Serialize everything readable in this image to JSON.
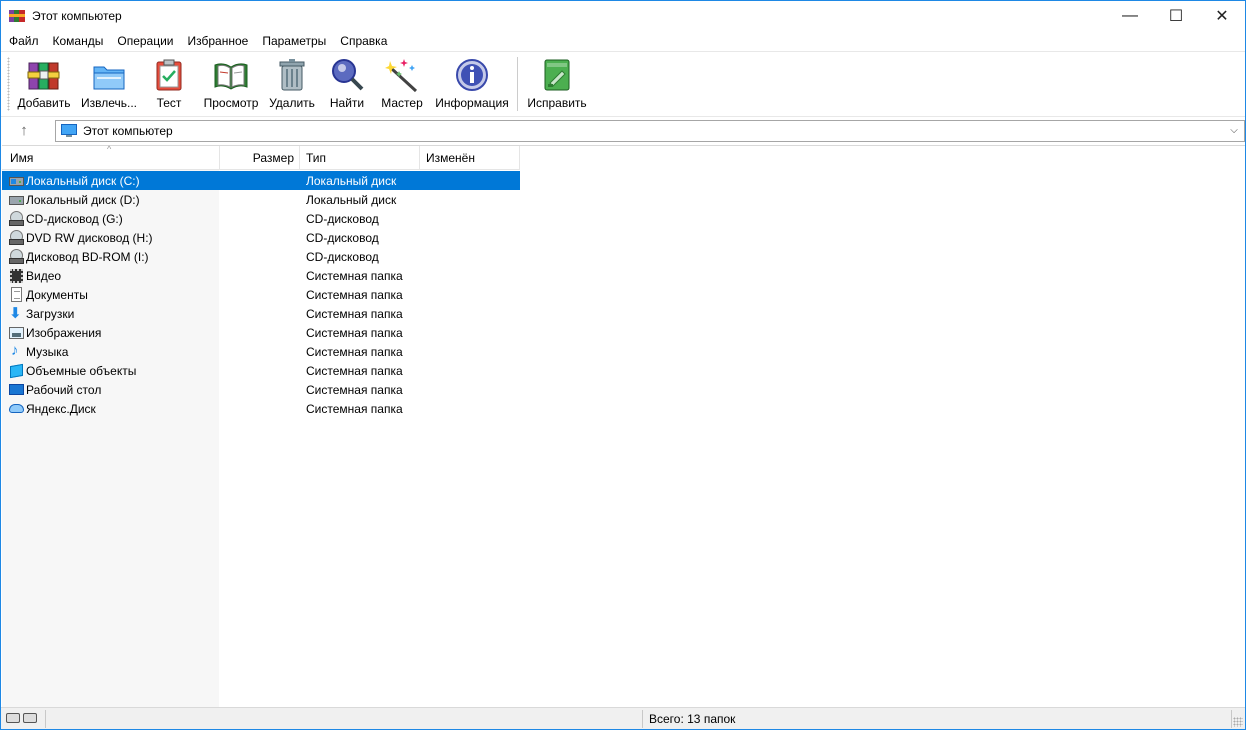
{
  "window": {
    "title": "Этот компьютер",
    "controls": {
      "minimize": "—",
      "maximize": "☐",
      "close": "✕"
    }
  },
  "menu": [
    "Файл",
    "Команды",
    "Операции",
    "Избранное",
    "Параметры",
    "Справка"
  ],
  "toolbar": {
    "buttons": [
      {
        "label": "Добавить",
        "icon": "add-archive-icon"
      },
      {
        "label": "Извлечь...",
        "icon": "extract-folder-icon"
      },
      {
        "label": "Тест",
        "icon": "test-clipboard-icon"
      },
      {
        "label": "Просмотр",
        "icon": "view-book-icon"
      },
      {
        "label": "Удалить",
        "icon": "trash-icon"
      },
      {
        "label": "Найти",
        "icon": "search-magnifier-icon"
      },
      {
        "label": "Мастер",
        "icon": "wizard-wand-icon"
      },
      {
        "label": "Информация",
        "icon": "info-icon"
      },
      {
        "label": "Исправить",
        "icon": "repair-icon"
      }
    ]
  },
  "address": {
    "up_symbol": "↑",
    "path": "Этот компьютер",
    "dropdown_symbol": "⌵"
  },
  "list": {
    "columns": {
      "name": "Имя",
      "size": "Размер",
      "type": "Тип",
      "modified": "Изменён"
    },
    "sort_indicator": "^",
    "rows": [
      {
        "name": "Локальный диск (C:)",
        "type": "Локальный диск",
        "icon": "local-disk-icon",
        "selected": true
      },
      {
        "name": "Локальный диск (D:)",
        "type": "Локальный диск",
        "icon": "local-disk-icon",
        "selected": false
      },
      {
        "name": "CD-дисковод (G:)",
        "type": "CD-дисковод",
        "icon": "cd-drive-icon",
        "selected": false
      },
      {
        "name": "DVD RW дисковод (H:)",
        "type": "CD-дисковод",
        "icon": "cd-drive-icon",
        "selected": false
      },
      {
        "name": "Дисковод BD-ROM (I:)",
        "type": "CD-дисковод",
        "icon": "cd-drive-icon",
        "selected": false
      },
      {
        "name": "Видео",
        "type": "Системная папка",
        "icon": "video-folder-icon",
        "selected": false
      },
      {
        "name": "Документы",
        "type": "Системная папка",
        "icon": "documents-folder-icon",
        "selected": false
      },
      {
        "name": "Загрузки",
        "type": "Системная папка",
        "icon": "downloads-folder-icon",
        "selected": false
      },
      {
        "name": "Изображения",
        "type": "Системная папка",
        "icon": "pictures-folder-icon",
        "selected": false
      },
      {
        "name": "Музыка",
        "type": "Системная папка",
        "icon": "music-folder-icon",
        "selected": false
      },
      {
        "name": "Объемные объекты",
        "type": "Системная папка",
        "icon": "3d-objects-folder-icon",
        "selected": false
      },
      {
        "name": "Рабочий стол",
        "type": "Системная папка",
        "icon": "desktop-folder-icon",
        "selected": false
      },
      {
        "name": "Яндекс.Диск",
        "type": "Системная папка",
        "icon": "yandex-disk-icon",
        "selected": false
      }
    ]
  },
  "status": {
    "total": "Всего: 13 папок"
  },
  "colors": {
    "selection": "#0078d7",
    "window_border": "#1e88e5"
  }
}
